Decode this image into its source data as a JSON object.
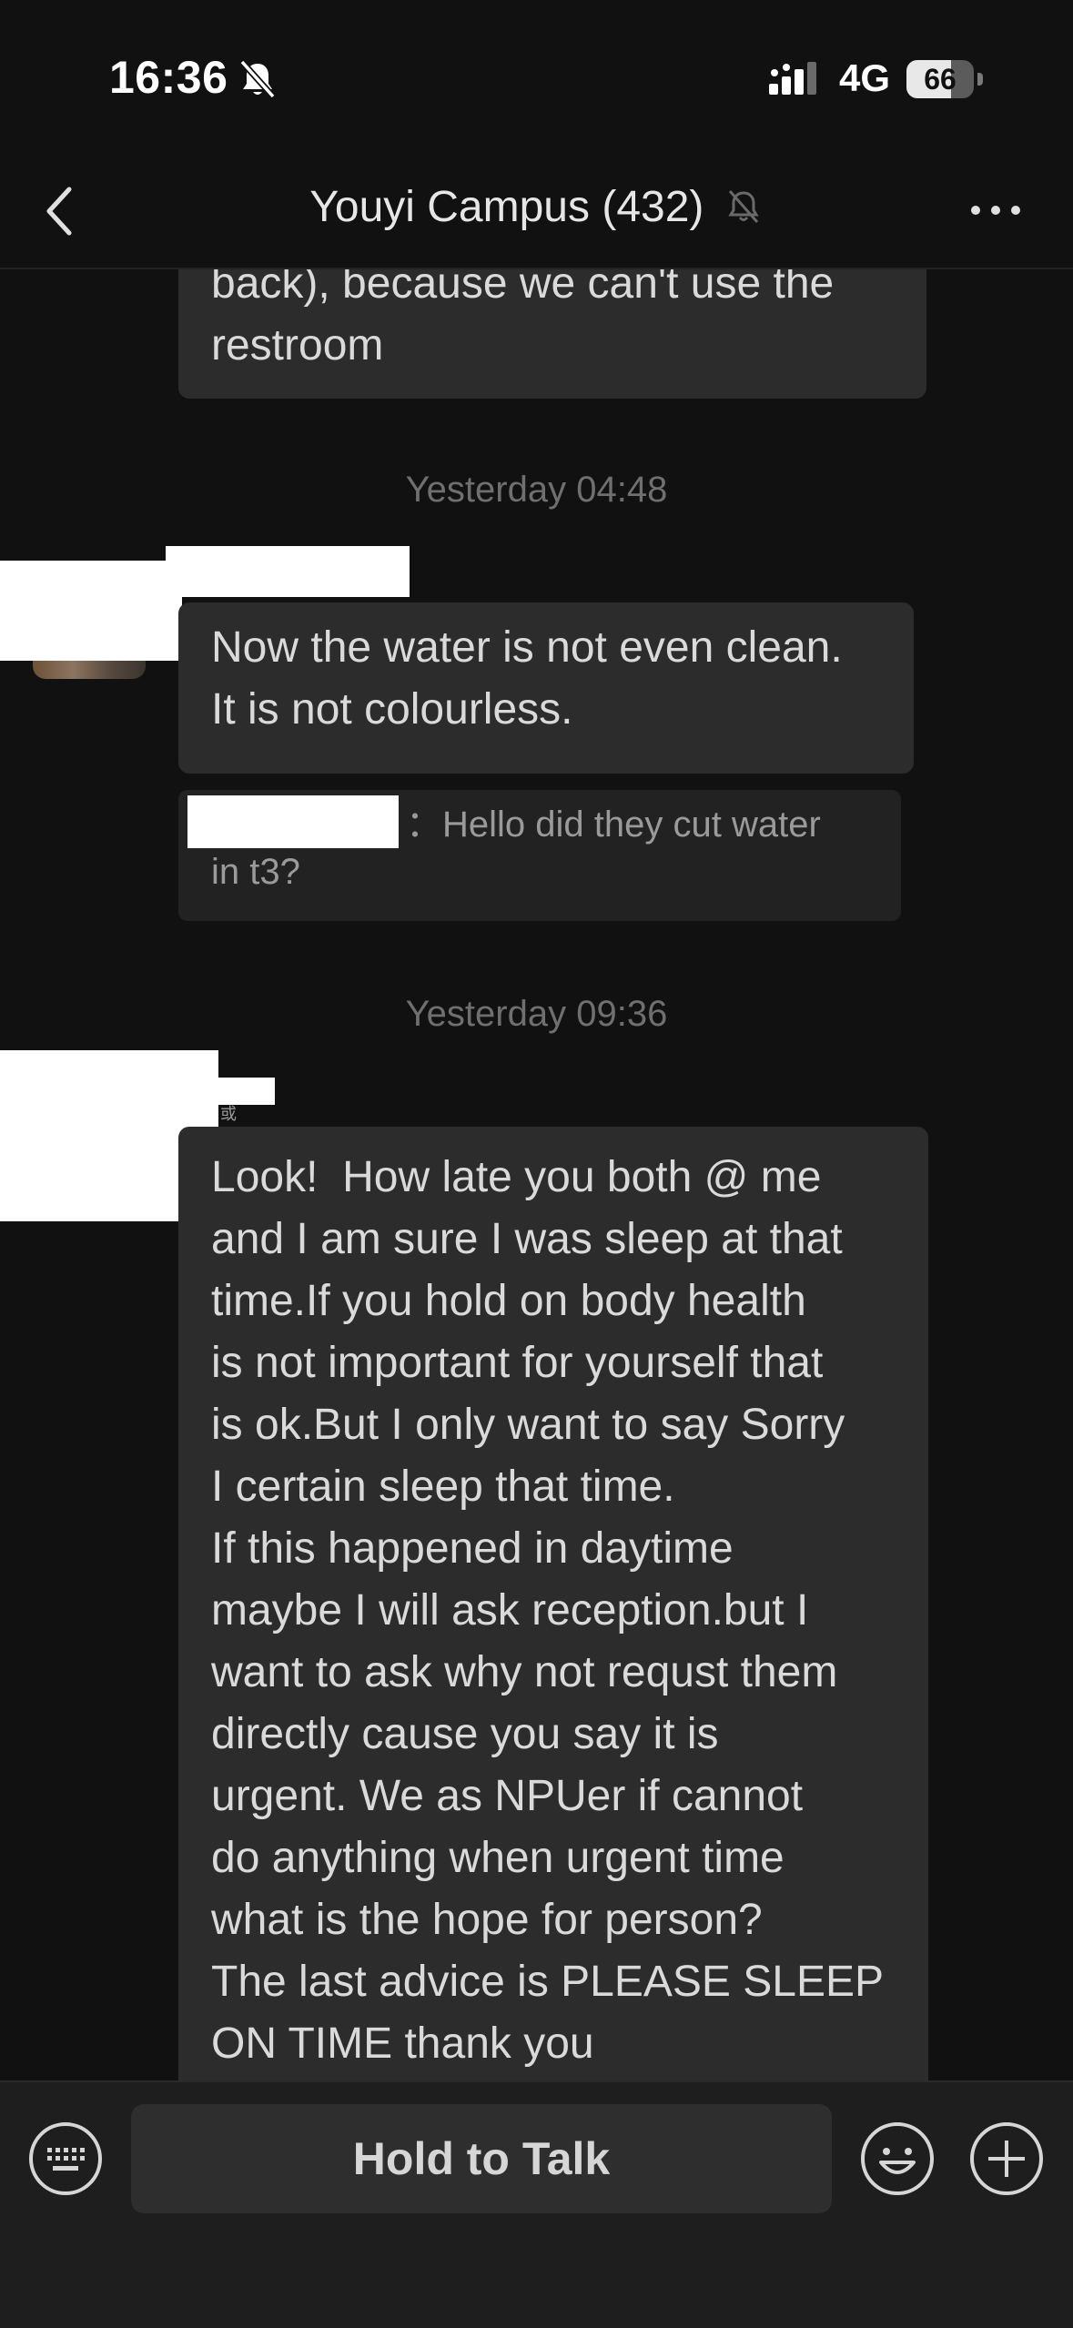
{
  "status_bar": {
    "time": "16:36",
    "network": "4G",
    "battery_level": "66",
    "battery_fraction": 0.66
  },
  "nav": {
    "title": "Youyi Campus (432)"
  },
  "messages": {
    "partial_top": {
      "text": "back), because we can't use the\nrestroom"
    },
    "timestamp_1": "Yesterday 04:48",
    "message_1": {
      "text": "Now the water is not even clean.\nIt is not colourless."
    },
    "quote_1": {
      "separator": "：",
      "text": "Hello did they cut water",
      "text_line2": "in t3?"
    },
    "timestamp_2": "Yesterday 09:36",
    "sender_tag": "或",
    "message_2": {
      "text": "Look!  How late you both @ me\nand I am sure I was sleep at that\ntime.If you hold on body health\nis not important for yourself that\nis ok.But I only want to say Sorry\nI certain sleep that time.\nIf this happened in daytime\nmaybe I will ask reception.but I\nwant to ask why not requst them\ndirectly cause you say it is\nurgent. We as NPUer if cannot\ndo anything when urgent time\nwhat is the hope for person?\nThe last advice is PLEASE SLEEP\nON TIME thank you"
    }
  },
  "input_bar": {
    "talk_label": "Hold to Talk"
  },
  "icons": {
    "status_mute": "bell-slash-icon",
    "signal": "cellular-signal-icon",
    "back": "chevron-left-icon",
    "title_mute": "bell-slash-icon",
    "more": "ellipsis-icon",
    "keyboard": "keyboard-icon",
    "emoji": "smiley-icon",
    "plus": "plus-circle-icon"
  }
}
